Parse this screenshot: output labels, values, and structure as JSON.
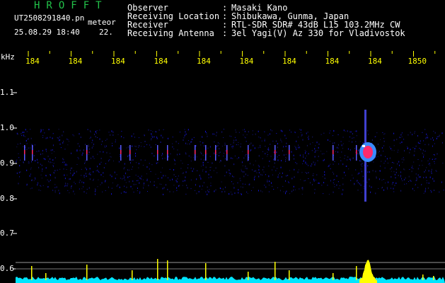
{
  "header": {
    "brand": "HROFFT",
    "filename": "UT2508291840.pn",
    "mode": "meteor",
    "datetime": "25.08.29 18:40",
    "suffix": "22.",
    "fields": [
      {
        "label": "Observer",
        "value": "Masaki Kano"
      },
      {
        "label": "Receiving Location",
        "value": "Shibukawa, Gunma, Japan"
      },
      {
        "label": "Receiver",
        "value": "RTL-SDR SDR# 43dB L15 103.2MHz CW"
      },
      {
        "label": "Receiving Antenna",
        "value": "3el Yagi(V) Az 330 for Vladivostok"
      }
    ],
    "separator": ":"
  },
  "axis": {
    "unit": "kHz",
    "x_ticks": [
      "184",
      "184",
      "184",
      "184",
      "184",
      "184",
      "184",
      "184",
      "184",
      "1850"
    ],
    "y_ticks": [
      "1.1",
      "1.0",
      "0.9",
      "0.8",
      "0.7",
      "0.6"
    ]
  },
  "colors": {
    "background": "#000000",
    "brand": "#22c24a",
    "tick": "#ffff00",
    "noise": "#1a1aa8",
    "meteor": "#ff2a6a",
    "spectrum": "#ffff00",
    "baseline": "#00e5ff"
  }
}
